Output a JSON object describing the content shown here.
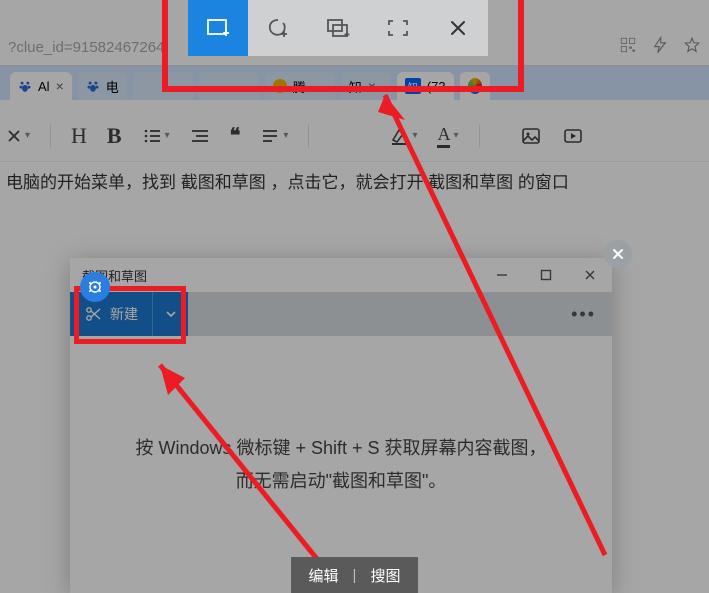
{
  "url_fragment": "?clue_id=91582467264",
  "tabs": [
    {
      "label": "Al",
      "platform": "baidu"
    },
    {
      "label": "电",
      "platform": "baidu"
    },
    {
      "label": "",
      "platform": "baidu"
    },
    {
      "label": "",
      "platform": "baidu"
    },
    {
      "label": "腾",
      "platform": "tencent"
    },
    {
      "label": "知",
      "platform": "other"
    },
    {
      "label": "(73",
      "platform": "zhihu"
    }
  ],
  "editor": {
    "heading": "H",
    "bold": "B",
    "quote": "❝"
  },
  "body_text": "电脑的开始菜单，找到 截图和草图 ，点击它，就会打开 截图和草图 的窗口",
  "snip_window": {
    "title": "截图和草图",
    "new_button": "新建",
    "message_line1": "按 Windows 微标键 + Shift + S 获取屏幕内容截图，",
    "message_line2": "而无需启动\"截图和草图\"。"
  },
  "bottom_bar": {
    "edit": "编辑",
    "search": "搜图"
  }
}
